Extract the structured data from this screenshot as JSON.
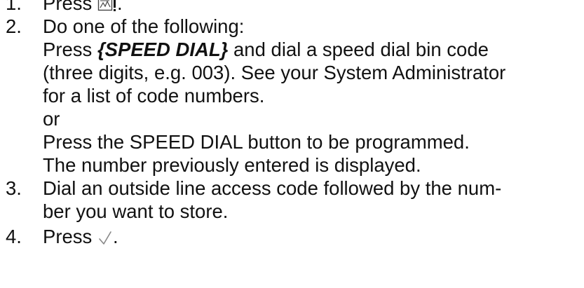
{
  "steps": [
    {
      "number": "1.",
      "text": "Press",
      "icon": "program-memo-icon",
      "after": "."
    },
    {
      "number": "2.",
      "lead": "Do one of the following:",
      "option_a": {
        "prefix": "Press ",
        "key": "{SPEED DIAL}",
        "line1_rest": " and dial a speed dial bin code",
        "line2": "(three digits, e.g. 003). See your System Administrator",
        "line3": "for a list of code numbers."
      },
      "or_text": "or",
      "option_b": {
        "line1": "Press the SPEED DIAL button to be programmed.",
        "line2": "The number previously entered is displayed."
      }
    },
    {
      "number": "3.",
      "line1": "Dial an outside line access code followed by the num-",
      "line2": "ber you want to store."
    },
    {
      "number": "4.",
      "text": "Press",
      "icon": "checkmark-icon",
      "after": "."
    }
  ]
}
